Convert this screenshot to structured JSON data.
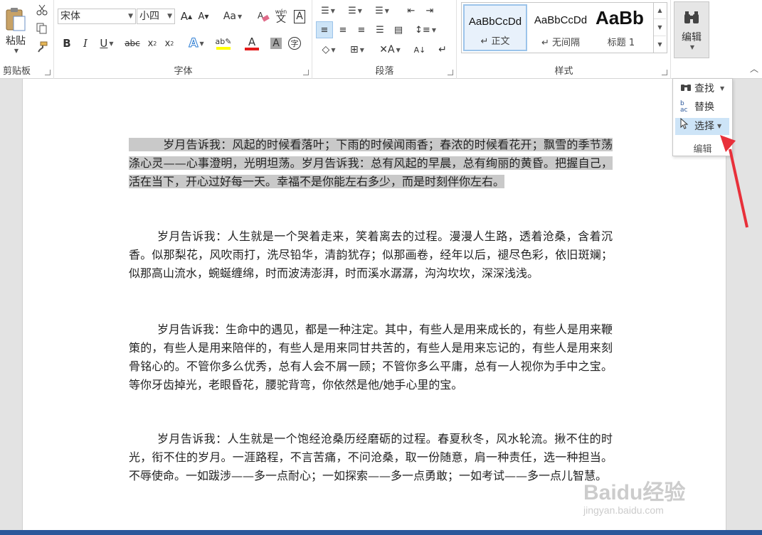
{
  "clipboard": {
    "paste_label": "粘贴",
    "group_label": "剪贴板"
  },
  "font": {
    "font_name": "宋体",
    "font_size": "小四",
    "group_label": "字体",
    "aa_label": "Aa",
    "wen_label": "wén"
  },
  "paragraph": {
    "group_label": "段落"
  },
  "styles": {
    "group_label": "样式",
    "items": [
      {
        "preview": "AaBbCcDd",
        "name": "↵ 正文"
      },
      {
        "preview": "AaBbCcDd",
        "name": "↵ 无间隔"
      },
      {
        "preview": "AaBb",
        "name": "标题 1"
      }
    ]
  },
  "editing": {
    "label": "编辑"
  },
  "dropdown": {
    "find": "查找",
    "replace": "替换",
    "select": "选择",
    "group_label": "编辑"
  },
  "document": {
    "paragraphs": [
      "岁月告诉我：风起的时候看落叶；下雨的时候闻雨香；春浓的时候看花开；飘雪的季节荡涤心灵——心事澄明，光明坦荡。岁月告诉我：总有风起的早晨，总有绚丽的黄昏。把握自己，活在当下，开心过好每一天。幸福不是你能左右多少，而是时刻伴你左右。",
      "岁月告诉我：人生就是一个哭着走来，笑着离去的过程。漫漫人生路，透着沧桑，含着沉香。似那梨花，风吹雨打，洗尽铅华，清韵犹存；似那画卷，经年以后，褪尽色彩，依旧斑斓；似那高山流水，蜿蜒缠绵，时而波涛澎湃，时而溪水潺潺，沟沟坎坎，深深浅浅。",
      "岁月告诉我：生命中的遇见，都是一种注定。其中，有些人是用来成长的，有些人是用来鞭策的，有些人是用来陪伴的，有些人是用来同甘共苦的，有些人是用来忘记的，有些人是用来刻骨铭心的。不管你多么优秀，总有人会不屑一顾；不管你多么平庸，总有一人视你为手中之宝。等你牙齿掉光，老眼昏花，腰驼背弯，你依然是他/她手心里的宝。",
      "岁月告诉我：人生就是一个饱经沧桑历经磨砺的过程。春夏秋冬，风水轮流。揪不住的时光，衔不住的岁月。一涯路程，不言苦痛，不问沧桑，取一份随意，肩一种责任，选一种担当。不辱使命。一如跋涉——多一点耐心；一如探索——多一点勇敢；一如考试——多一点儿智慧。"
    ]
  },
  "watermark": {
    "text": "Baidu经验",
    "url": "jingyan.baidu.com"
  },
  "colors": {
    "accent": "#2b579a",
    "arrow": "#e8303a",
    "selection": "#c9c9c9",
    "hover": "#cde4f7"
  }
}
